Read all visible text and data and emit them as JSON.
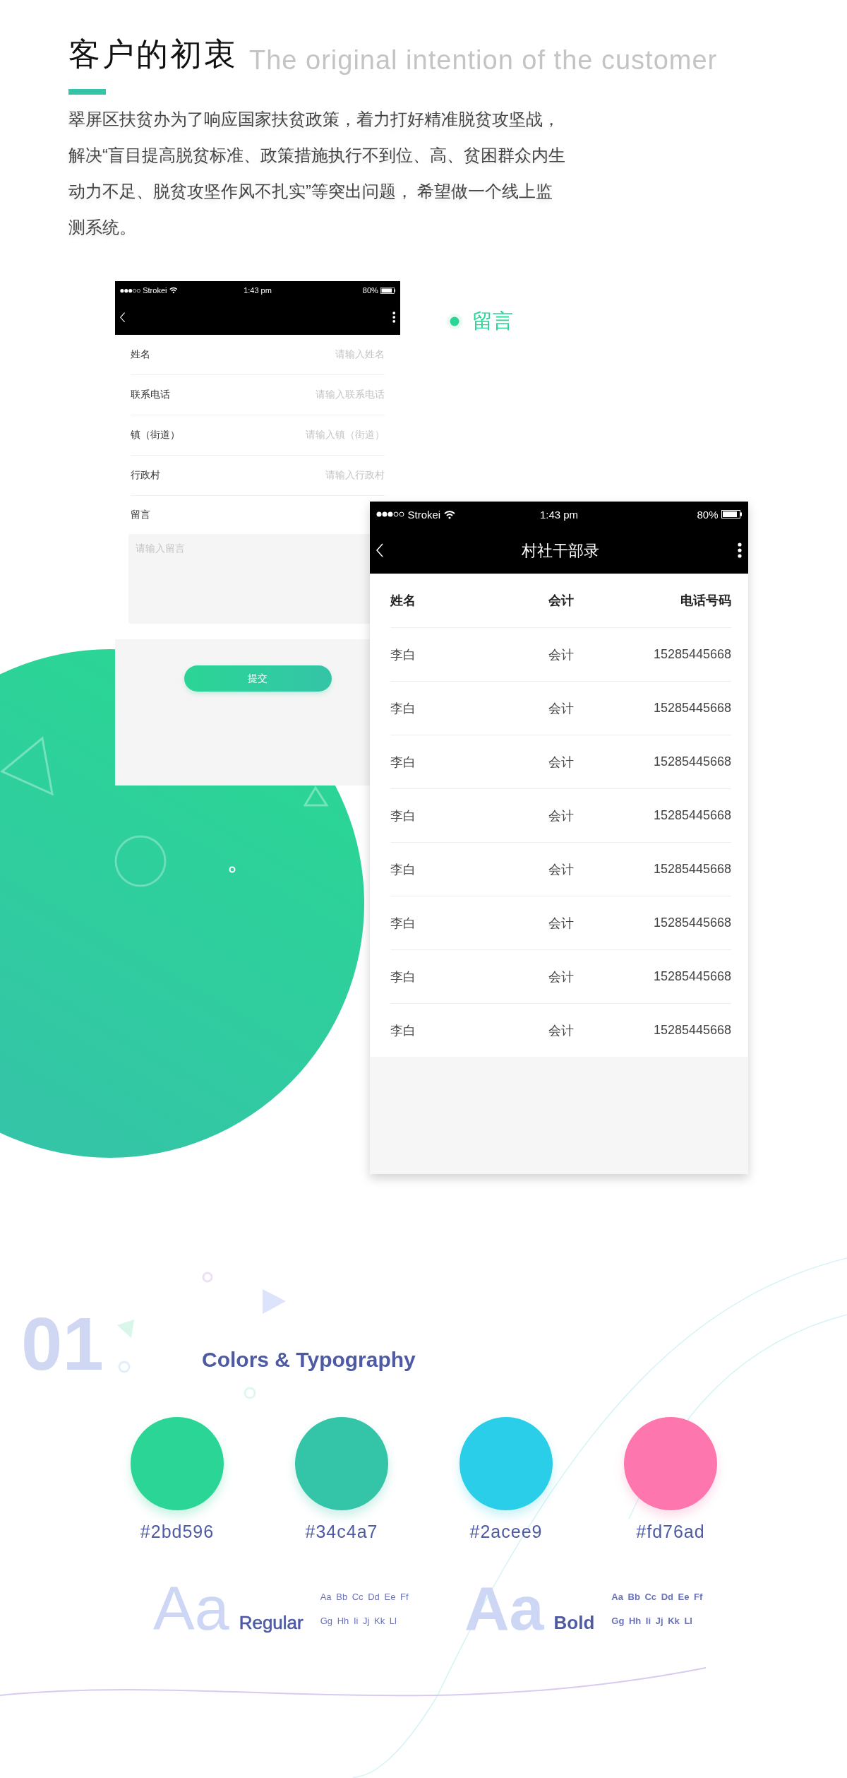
{
  "header": {
    "title": "客户的初衷",
    "subtitle": "The original intention of the customer",
    "description": "翠屏区扶贫办为了响应国家扶贫政策，着力打好精准脱贫攻坚战，解决“盲目提高脱贫标准、政策措施执行不到位、高、贫困群众内生动力不足、脱贫攻坚作风不扎实”等突出问题， 希望做一个线上监测系统。"
  },
  "form_screen": {
    "status_bar": {
      "carrier": "Strokei",
      "time": "1:43 pm",
      "battery": "80%"
    },
    "fields": [
      {
        "label": "姓名",
        "placeholder": "请输入姓名"
      },
      {
        "label": "联系电话",
        "placeholder": "请输入联系电话"
      },
      {
        "label": "镇（街道）",
        "placeholder": "请输入镇（街道）"
      },
      {
        "label": "行政村",
        "placeholder": "请输入行政村"
      }
    ],
    "message": {
      "label": "留言",
      "placeholder": "请输入留言"
    },
    "submit_button": "提交"
  },
  "callout": {
    "label": "留言"
  },
  "table_screen": {
    "status_bar": {
      "carrier": "Strokei",
      "time": "1:43 pm",
      "battery": "80%"
    },
    "title": "村社干部录",
    "columns": [
      "姓名",
      "会计",
      "电话号码"
    ],
    "rows": [
      [
        "李白",
        "会计",
        "15285445668"
      ],
      [
        "李白",
        "会计",
        "15285445668"
      ],
      [
        "李白",
        "会计",
        "15285445668"
      ],
      [
        "李白",
        "会计",
        "15285445668"
      ],
      [
        "李白",
        "会计",
        "15285445668"
      ],
      [
        "李白",
        "会计",
        "15285445668"
      ],
      [
        "李白",
        "会计",
        "15285445668"
      ],
      [
        "李白",
        "会计",
        "15285445668"
      ]
    ]
  },
  "section": {
    "number": "01",
    "title": "Colors & Typography"
  },
  "colors": [
    {
      "label": "#2bd596",
      "color": "#2bd596"
    },
    {
      "label": "#34c4a7",
      "color": "#34c4a7"
    },
    {
      "label": "#2acee9",
      "color": "#2acee9"
    },
    {
      "label": "#fd76ad",
      "color": "#fd76ad"
    }
  ],
  "typography": [
    {
      "kind": "regular",
      "sample": "Aa",
      "name": "Regular",
      "letters": [
        "Aa Bb Cc Dd Ee Ff",
        "Gg Hh Ii Jj Kk Ll"
      ]
    },
    {
      "kind": "bold",
      "sample": "Aa",
      "name": "Bold",
      "letters": [
        "Aa Bb Cc Dd Ee Ff",
        "Gg Hh Ii Jj Kk Ll"
      ]
    }
  ]
}
